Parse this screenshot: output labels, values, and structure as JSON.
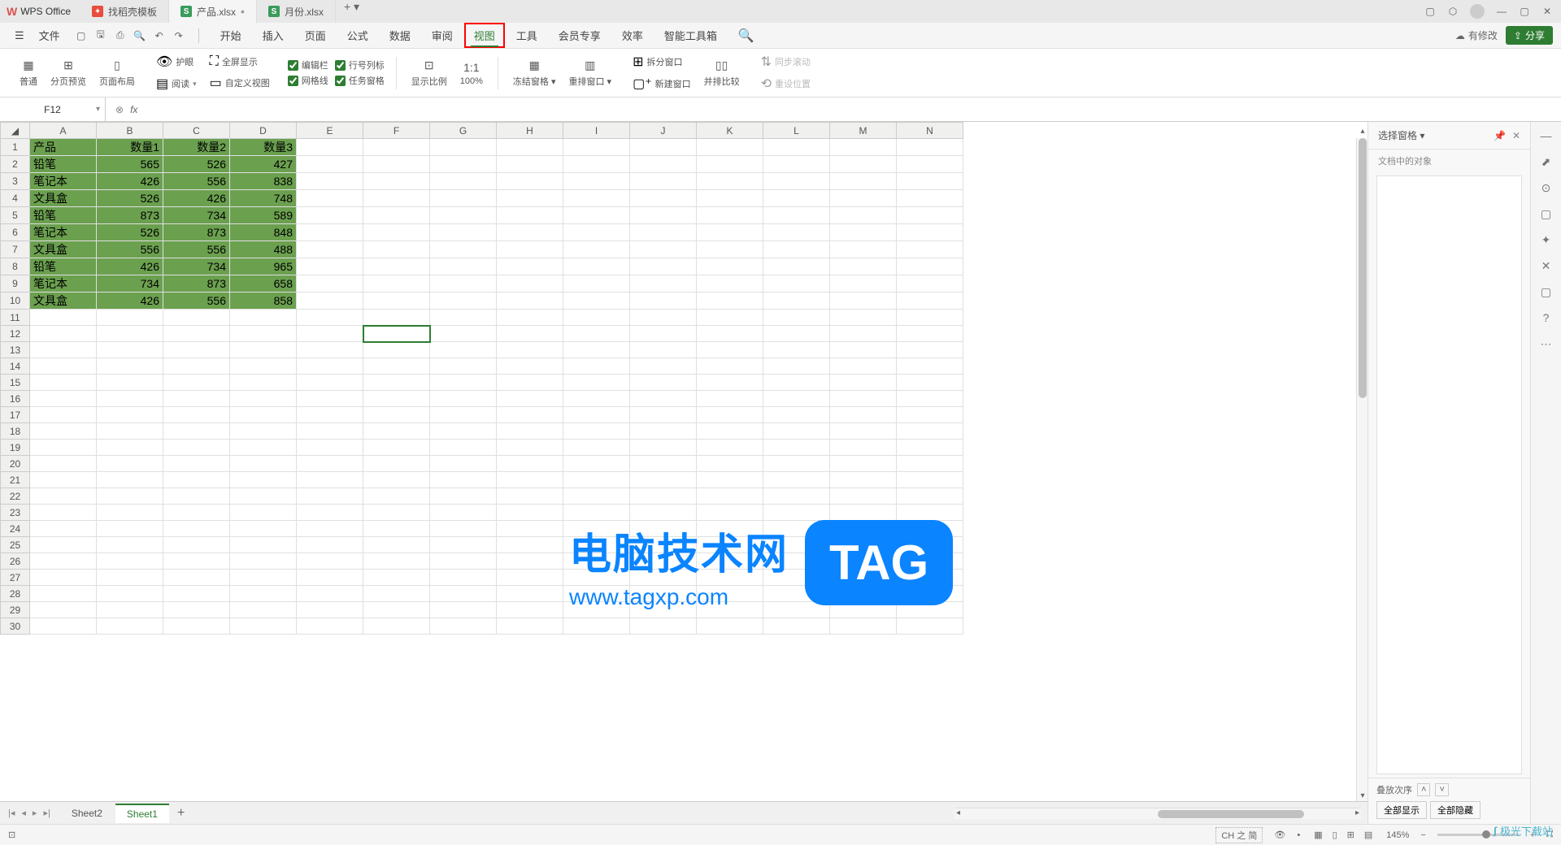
{
  "app": {
    "name": "WPS Office"
  },
  "tabs": [
    {
      "label": "找稻壳模板",
      "type": "d"
    },
    {
      "label": "产品.xlsx",
      "type": "s",
      "active": true,
      "modified": true
    },
    {
      "label": "月份.xlsx",
      "type": "s"
    }
  ],
  "menubar": {
    "file": "文件",
    "edit_status": "有修改",
    "share": "分享"
  },
  "ribbon_tabs": [
    "开始",
    "插入",
    "页面",
    "公式",
    "数据",
    "审阅",
    "视图",
    "工具",
    "会员专享",
    "效率",
    "智能工具箱"
  ],
  "active_ribbon_tab": "视图",
  "ribbon": {
    "normal": "普通",
    "page_break": "分页预览",
    "page_layout": "页面布局",
    "eye_protect": "护眼",
    "fullscreen": "全屏显示",
    "reading": "阅读",
    "custom_view": "自定义视图",
    "edit_bar": "编辑栏",
    "row_col_label": "行号列标",
    "gridlines": "网格线",
    "task_pane": "任务窗格",
    "zoom": "显示比例",
    "zoom_100": "100%",
    "freeze": "冻结窗格",
    "arrange": "重排窗口",
    "split": "拆分窗口",
    "new_window": "新建窗口",
    "side_by_side": "并排比较",
    "sync_scroll": "同步滚动",
    "reset_pos": "重设位置"
  },
  "formula_bar": {
    "cell_name": "F12",
    "fx": "fx",
    "value": ""
  },
  "columns": [
    "A",
    "B",
    "C",
    "D",
    "E",
    "F",
    "G",
    "H",
    "I",
    "J",
    "K",
    "L",
    "M",
    "N"
  ],
  "row_count": 30,
  "sheet_data": {
    "header": [
      "产品",
      "数量1",
      "数量2",
      "数量3"
    ],
    "rows": [
      [
        "铅笔",
        565,
        526,
        427
      ],
      [
        "笔记本",
        426,
        556,
        838
      ],
      [
        "文具盒",
        526,
        426,
        748
      ],
      [
        "铅笔",
        873,
        734,
        589
      ],
      [
        "笔记本",
        526,
        873,
        848
      ],
      [
        "文具盒",
        556,
        556,
        488
      ],
      [
        "铅笔",
        426,
        734,
        965
      ],
      [
        "笔记本",
        734,
        873,
        658
      ],
      [
        "文具盒",
        426,
        556,
        858
      ]
    ]
  },
  "active_cell": "F12",
  "side_panel": {
    "title": "选择窗格",
    "label": "文档中的对象",
    "stacking": "叠放次序",
    "show_all": "全部显示",
    "hide_all": "全部隐藏"
  },
  "sheets": [
    "Sheet2",
    "Sheet1"
  ],
  "active_sheet": "Sheet1",
  "status": {
    "lang": "CH 之 简",
    "zoom": "145%"
  },
  "watermark": {
    "text": "电脑技术网",
    "url": "www.tagxp.com",
    "tag": "TAG",
    "dl": "极光下载站"
  }
}
